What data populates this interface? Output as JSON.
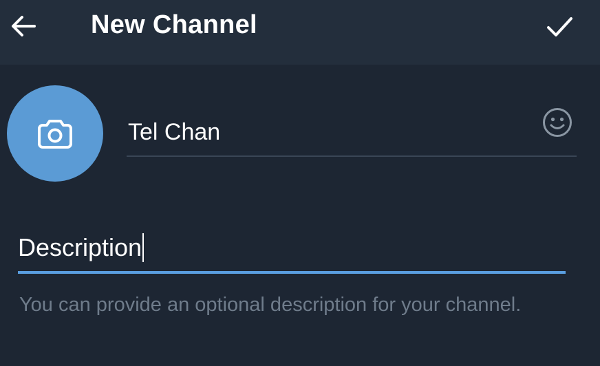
{
  "header": {
    "title": "New Channel",
    "back_icon": "arrow-left-icon",
    "confirm_icon": "checkmark-icon"
  },
  "channel_photo": {
    "icon": "camera-icon",
    "color": "#5b9bd5"
  },
  "channel_name": {
    "value": "Tel Chan",
    "emoji_icon": "smiley-face-icon"
  },
  "description": {
    "value": "Description",
    "hint": "You can provide an optional description for your channel."
  },
  "colors": {
    "background": "#1d2633",
    "app_bar": "#232e3c",
    "accent": "#5a9ee0",
    "hint_text": "#6f7c8b"
  }
}
